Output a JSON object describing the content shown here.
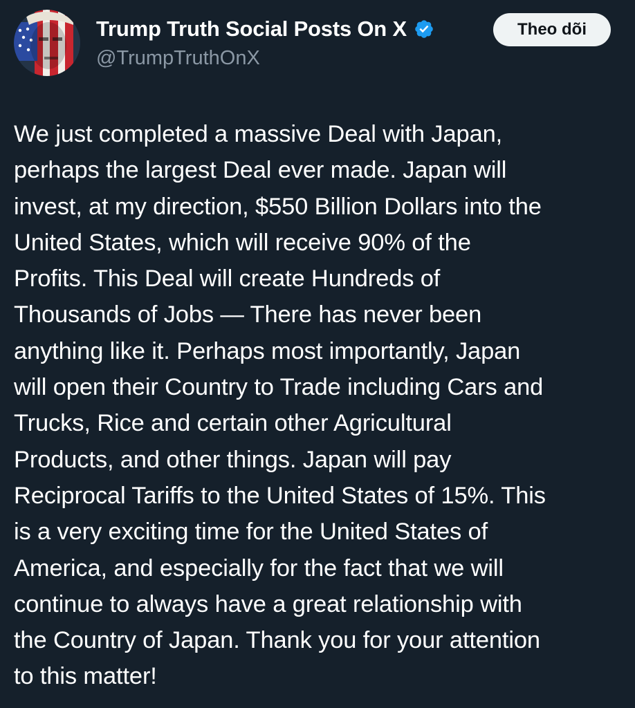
{
  "account": {
    "display_name": "Trump Truth Social Posts On X",
    "handle": "@TrumpTruthOnX",
    "verified": true,
    "avatar_icon": "flag-portrait-avatar"
  },
  "follow_button": {
    "label": "Theo dõi"
  },
  "post": {
    "lines": [
      "We just completed a massive Deal with Japan,",
      "perhaps the largest Deal ever made. Japan will",
      "invest, at my direction, $550 Billion Dollars into the",
      "United States, which will receive 90% of the",
      "Profits. This Deal will create Hundreds of",
      "Thousands of Jobs — There has never been",
      "anything like it. Perhaps most importantly, Japan",
      "will open their Country to Trade including Cars and",
      "Trucks, Rice and certain other Agricultural",
      "Products, and other things. Japan will pay",
      "Reciprocal Tariffs to the United States of 15%. This",
      "is a very exciting time for the United States of",
      "America, and especially for the fact that we will",
      "continue to always have a great relationship with",
      "the Country of Japan. Thank you for your attention",
      "to this matter!"
    ]
  },
  "colors": {
    "background": "#15202b",
    "text_primary": "#ffffff",
    "text_secondary": "#8b98a5",
    "verified_badge": "#1d9bf0",
    "follow_button_bg": "#eff3f4",
    "follow_button_text": "#0f1419"
  }
}
